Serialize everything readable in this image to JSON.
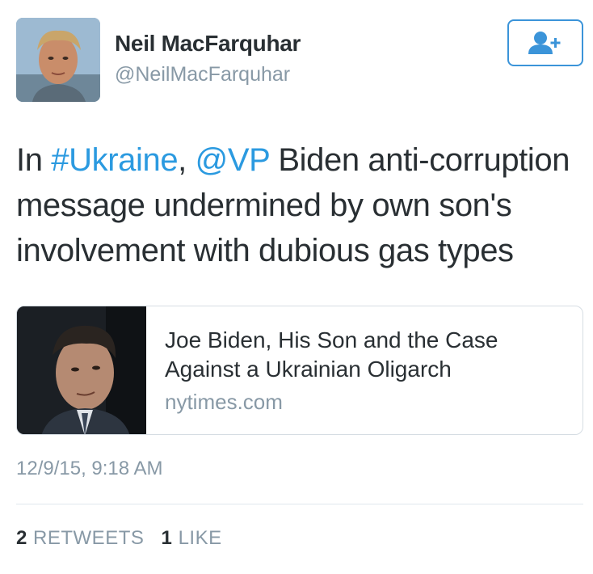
{
  "author": {
    "display_name": "Neil MacFarquhar",
    "handle": "@NeilMacFarquhar"
  },
  "follow_button": {
    "icon": "follow-user-icon"
  },
  "tweet": {
    "text_in": "In ",
    "hashtag": "#Ukraine",
    "comma": ", ",
    "mention": "@VP",
    "text_rest": " Biden anti-corruption message undermined by own son's involvement with dubious gas types"
  },
  "card": {
    "title": "Joe Biden, His Son and the Case Against a Ukrainian Oligarch",
    "domain": "nytimes.com"
  },
  "timestamp": "12/9/15, 9:18 AM",
  "stats": {
    "retweets_count": "2",
    "retweets_label": "RETWEETS",
    "likes_count": "1",
    "likes_label": "LIKE"
  },
  "colors": {
    "link": "#2b9ae0",
    "text": "#292f33",
    "secondary": "#8899a6",
    "button_border": "#3b94d9"
  }
}
